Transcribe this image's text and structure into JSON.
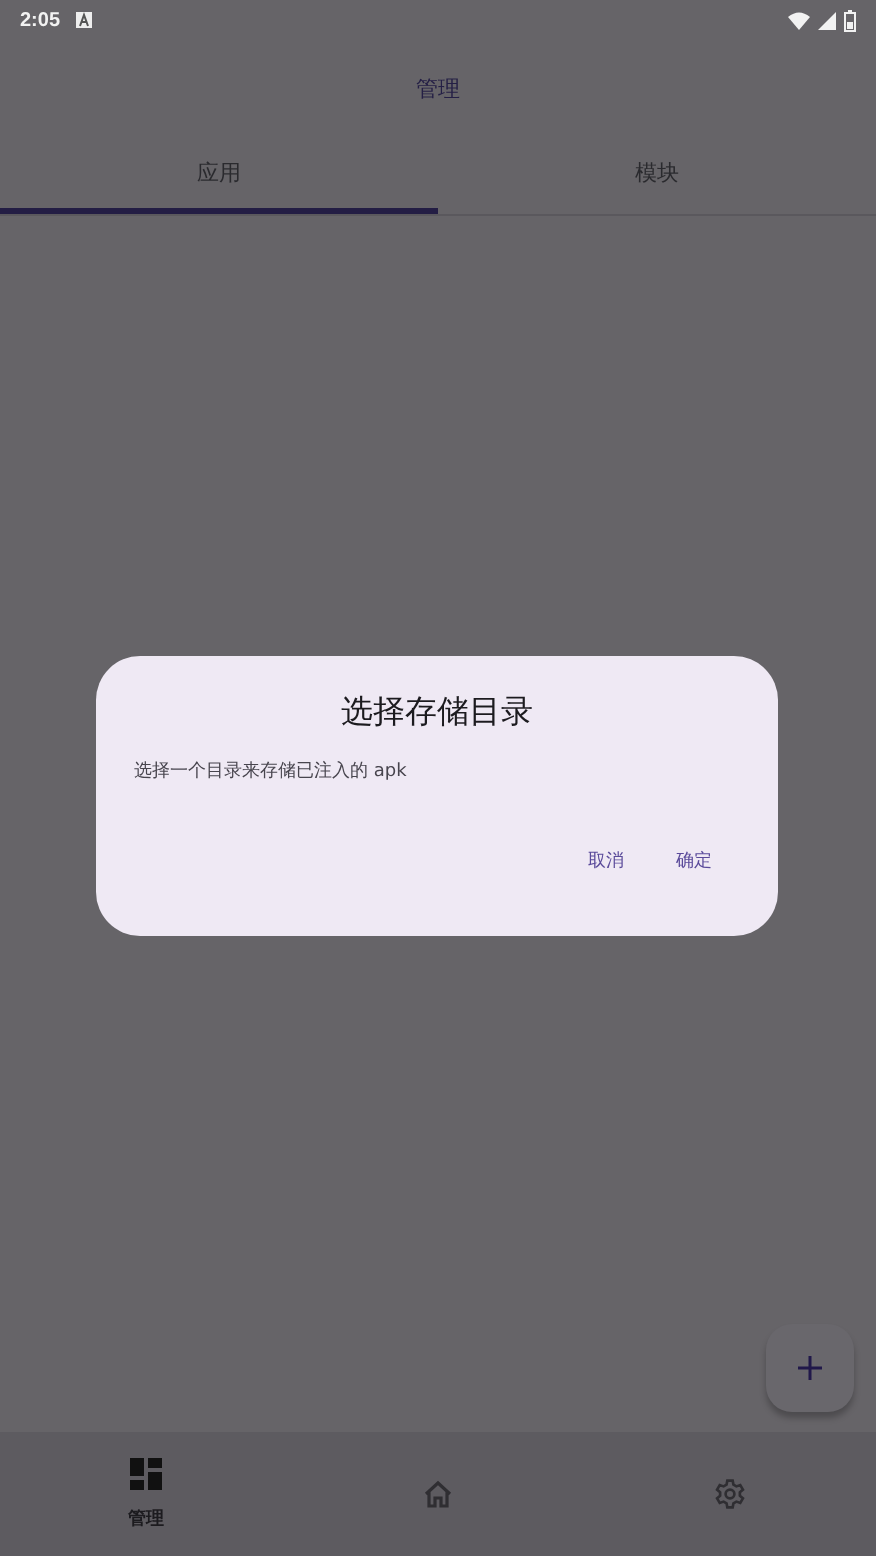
{
  "status_bar": {
    "time": "2:05"
  },
  "app_bar": {
    "title": "管理"
  },
  "tabs": [
    {
      "label": "应用",
      "selected": true
    },
    {
      "label": "模块",
      "selected": false
    }
  ],
  "dialog": {
    "title": "选择存储目录",
    "message": "选择一个目录来存储已注入的 apk",
    "buttons": [
      "取消",
      "确定"
    ]
  },
  "nav": [
    {
      "kind": "dashboard",
      "label": "管理",
      "selected": true
    },
    {
      "kind": "home",
      "selected": false
    },
    {
      "kind": "settings",
      "selected": false
    }
  ]
}
